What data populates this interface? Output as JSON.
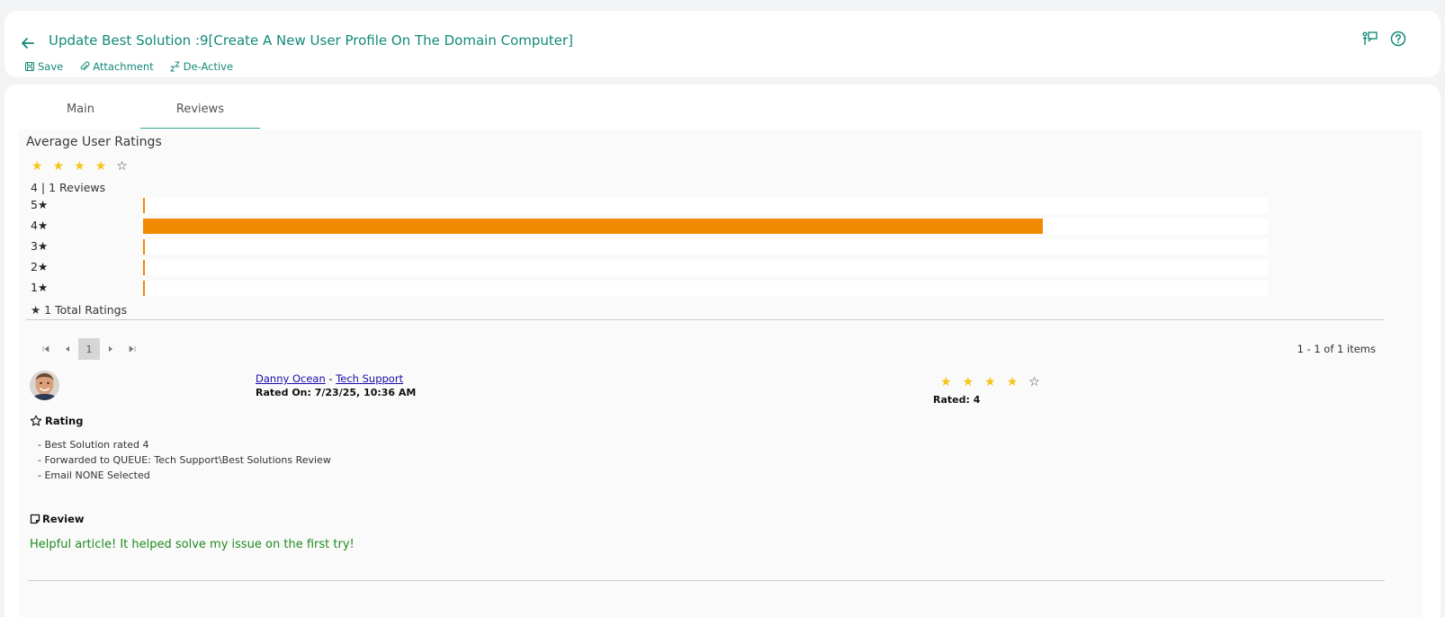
{
  "header": {
    "title": "Update Best Solution :9[Create A New User Profile On The Domain Computer]",
    "toolbar": {
      "save": "Save",
      "attachment": "Attachment",
      "deactive": "De-Active"
    },
    "icons": [
      "back-arrow-icon",
      "presenter-icon",
      "help-icon"
    ]
  },
  "tabs": [
    {
      "label": "Main"
    },
    {
      "label": "Reviews"
    }
  ],
  "ratings": {
    "title": "Average User Ratings",
    "average_stars": 4,
    "summary": "4 | 1 Reviews",
    "distribution": [
      {
        "label": "5★",
        "fraction": 0
      },
      {
        "label": "4★",
        "fraction": 0.8
      },
      {
        "label": "3★",
        "fraction": 0
      },
      {
        "label": "2★",
        "fraction": 0
      },
      {
        "label": "1★",
        "fraction": 0
      }
    ],
    "bar_color": "#f08a00",
    "total": "★ 1 Total Ratings"
  },
  "pager": {
    "page": "1",
    "items_count": "1 - 1 of 1 items"
  },
  "review": {
    "reviewer_name": "Danny Ocean",
    "separator": " - ",
    "reviewer_team": "Tech Support",
    "rated_on": "Rated On: 7/23/25, 10:36 AM",
    "stars": 4,
    "rated": "Rated: 4",
    "rating_heading": "Rating",
    "rating_lines": [
      "- Best Solution rated 4",
      "- Forwarded to QUEUE: Tech Support\\Best Solutions Review",
      "- Email NONE Selected"
    ],
    "review_heading": "Review",
    "review_text": "Helpful article! It helped solve my issue on the first try!"
  }
}
